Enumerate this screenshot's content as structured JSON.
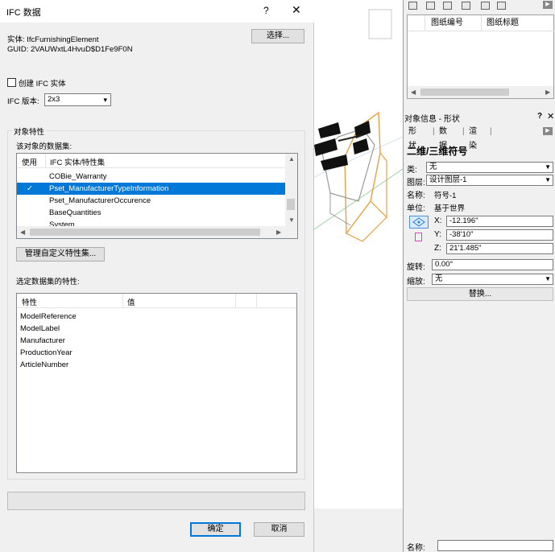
{
  "dialog": {
    "title": "IFC 数据",
    "help_glyph": "?",
    "close_glyph": "✕",
    "entity_label": "实体: IfcFurnishingElement",
    "guid_label": "GUID: 2VAUWxtL4HvuD$D1Fe9F0N",
    "select_button": "选择...",
    "create_entity_label": "创建 IFC 实体",
    "create_entity_checked": false,
    "ifc_version_label": "IFC 版本:",
    "ifc_version_value": "2x3",
    "group_object_properties": "对象特性",
    "datasets_label": "该对象的数据集:",
    "dataset_columns": [
      "使用",
      "IFC 实体/特性集"
    ],
    "datasets": [
      {
        "use": "",
        "name": "COBie_Warranty",
        "selected": false
      },
      {
        "use": "✓",
        "name": "Pset_ManufacturerTypeInformation",
        "selected": true
      },
      {
        "use": "",
        "name": "Pset_ManufacturerOccurence",
        "selected": false
      },
      {
        "use": "",
        "name": "BaseQuantities",
        "selected": false
      },
      {
        "use": "",
        "name": "System",
        "selected": false
      }
    ],
    "manage_button": "管理自定义特性集...",
    "selected_props_label": "选定数据集的特性:",
    "prop_columns": [
      "特性",
      "值"
    ],
    "properties": [
      "ModelReference",
      "ModelLabel",
      "Manufacturer",
      "ProductionYear",
      "ArticleNumber"
    ],
    "progress_fraction": 0,
    "ok_button": "确定",
    "cancel_button": "取消"
  },
  "sheet_list": {
    "columns": [
      "图纸编号",
      "图纸标题"
    ]
  },
  "object_info": {
    "title": "对象信息 - 形状",
    "help_glyph": "?",
    "close_glyph": "✕",
    "tabs": [
      "形状",
      "数据",
      "渲染"
    ],
    "section_title": "二维/三维符号",
    "class_label": "类:",
    "class_value": "无",
    "layer_label": "图层:",
    "layer_value": "设计图层-1",
    "name_label": "名称:",
    "name_value": "符号-1",
    "unit_label": "单位:",
    "unit_value": "基于世界",
    "x_label": "X:",
    "x_value": "-12.196\"",
    "y_label": "Y:",
    "y_value": "-38'10\"",
    "z_label": "Z:",
    "z_value": "21'1.485\"",
    "rotation_label": "旋转:",
    "rotation_value": "0.00°",
    "scale_label": "缩放:",
    "scale_value": "无",
    "replace_button": "替换..."
  },
  "bottom_name": {
    "label": "名称:"
  },
  "colors": {
    "selection": "#0078d7",
    "chair_frame_orange": "#e8a040",
    "chair_black": "#111111"
  }
}
